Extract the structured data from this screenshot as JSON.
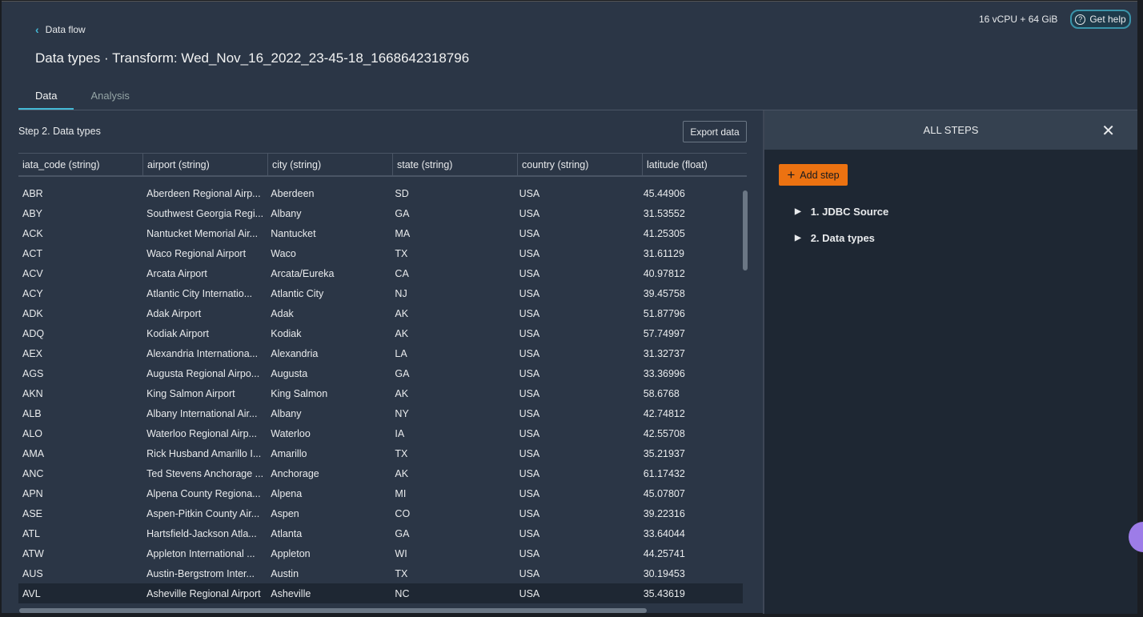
{
  "header": {
    "back_label": "Data flow",
    "title": "Data types · Transform: Wed_Nov_16_2022_23-45-18_1668642318796",
    "resources": "16 vCPU + 64 GiB",
    "help_label": "Get help"
  },
  "tabs": [
    {
      "label": "Data"
    },
    {
      "label": "Analysis"
    }
  ],
  "step_title": "Step 2. Data types",
  "export_label": "Export data",
  "table": {
    "columns": [
      "iata_code (string)",
      "airport (string)",
      "city (string)",
      "state (string)",
      "country (string)",
      "latitude (float)"
    ],
    "rows": [
      [
        "ABR",
        "Aberdeen Regional Airp...",
        "Aberdeen",
        "SD",
        "USA",
        "45.44906"
      ],
      [
        "ABY",
        "Southwest Georgia Regi...",
        "Albany",
        "GA",
        "USA",
        "31.53552"
      ],
      [
        "ACK",
        "Nantucket Memorial Air...",
        "Nantucket",
        "MA",
        "USA",
        "41.25305"
      ],
      [
        "ACT",
        "Waco Regional Airport",
        "Waco",
        "TX",
        "USA",
        "31.61129"
      ],
      [
        "ACV",
        "Arcata Airport",
        "Arcata/Eureka",
        "CA",
        "USA",
        "40.97812"
      ],
      [
        "ACY",
        "Atlantic City Internatio...",
        "Atlantic City",
        "NJ",
        "USA",
        "39.45758"
      ],
      [
        "ADK",
        "Adak Airport",
        "Adak",
        "AK",
        "USA",
        "51.87796"
      ],
      [
        "ADQ",
        "Kodiak Airport",
        "Kodiak",
        "AK",
        "USA",
        "57.74997"
      ],
      [
        "AEX",
        "Alexandria Internationa...",
        "Alexandria",
        "LA",
        "USA",
        "31.32737"
      ],
      [
        "AGS",
        "Augusta Regional Airpo...",
        "Augusta",
        "GA",
        "USA",
        "33.36996"
      ],
      [
        "AKN",
        "King Salmon Airport",
        "King Salmon",
        "AK",
        "USA",
        "58.6768"
      ],
      [
        "ALB",
        "Albany International Air...",
        "Albany",
        "NY",
        "USA",
        "42.74812"
      ],
      [
        "ALO",
        "Waterloo Regional Airp...",
        "Waterloo",
        "IA",
        "USA",
        "42.55708"
      ],
      [
        "AMA",
        "Rick Husband Amarillo I...",
        "Amarillo",
        "TX",
        "USA",
        "35.21937"
      ],
      [
        "ANC",
        "Ted Stevens Anchorage ...",
        "Anchorage",
        "AK",
        "USA",
        "61.17432"
      ],
      [
        "APN",
        "Alpena County Regiona...",
        "Alpena",
        "MI",
        "USA",
        "45.07807"
      ],
      [
        "ASE",
        "Aspen-Pitkin County Air...",
        "Aspen",
        "CO",
        "USA",
        "39.22316"
      ],
      [
        "ATL",
        "Hartsfield-Jackson Atla...",
        "Atlanta",
        "GA",
        "USA",
        "33.64044"
      ],
      [
        "ATW",
        "Appleton International ...",
        "Appleton",
        "WI",
        "USA",
        "44.25741"
      ],
      [
        "AUS",
        "Austin-Bergstrom Inter...",
        "Austin",
        "TX",
        "USA",
        "30.19453"
      ],
      [
        "AVL",
        "Asheville Regional Airport",
        "Asheville",
        "NC",
        "USA",
        "35.43619"
      ]
    ]
  },
  "panel": {
    "title": "ALL STEPS",
    "add_label": "Add step",
    "steps": [
      {
        "label": "1. JDBC Source"
      },
      {
        "label": "2. Data types"
      }
    ]
  },
  "colors": {
    "accent": "#ec7211",
    "link": "#44b9d6",
    "background": "#2b3646"
  }
}
